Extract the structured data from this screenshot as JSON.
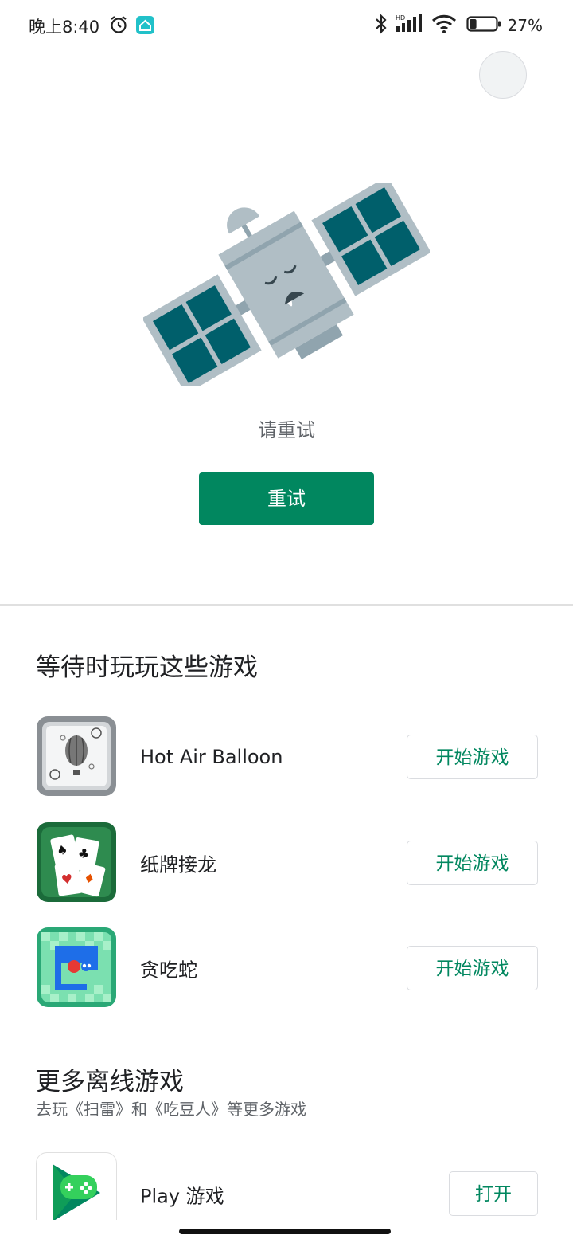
{
  "status_bar": {
    "time": "晚上8:40",
    "battery_percent": "27%",
    "battery_level": 0.27,
    "icons": [
      "alarm-icon",
      "home-app-icon",
      "bluetooth-icon",
      "hd-signal-icon",
      "wifi-icon",
      "battery-icon"
    ]
  },
  "error": {
    "message": "请重试",
    "retry_label": "重试"
  },
  "colors": {
    "accent": "#01875f",
    "background": "#ffffff",
    "divider": "#e0e0e0",
    "secondary_text": "#5f6368"
  },
  "games_section": {
    "title": "等待时玩玩这些游戏",
    "games": [
      {
        "name": "Hot Air Balloon",
        "button": "开始游戏",
        "icon": "hot-air-balloon-icon"
      },
      {
        "name": "纸牌接龙",
        "button": "开始游戏",
        "icon": "solitaire-icon"
      },
      {
        "name": "贪吃蛇",
        "button": "开始游戏",
        "icon": "snake-icon"
      }
    ]
  },
  "more_section": {
    "title": "更多离线游戏",
    "subtitle": "去玩《扫雷》和《吃豆人》等更多游戏",
    "app": {
      "name": "Play 游戏",
      "button": "打开",
      "icon": "play-games-icon"
    }
  }
}
